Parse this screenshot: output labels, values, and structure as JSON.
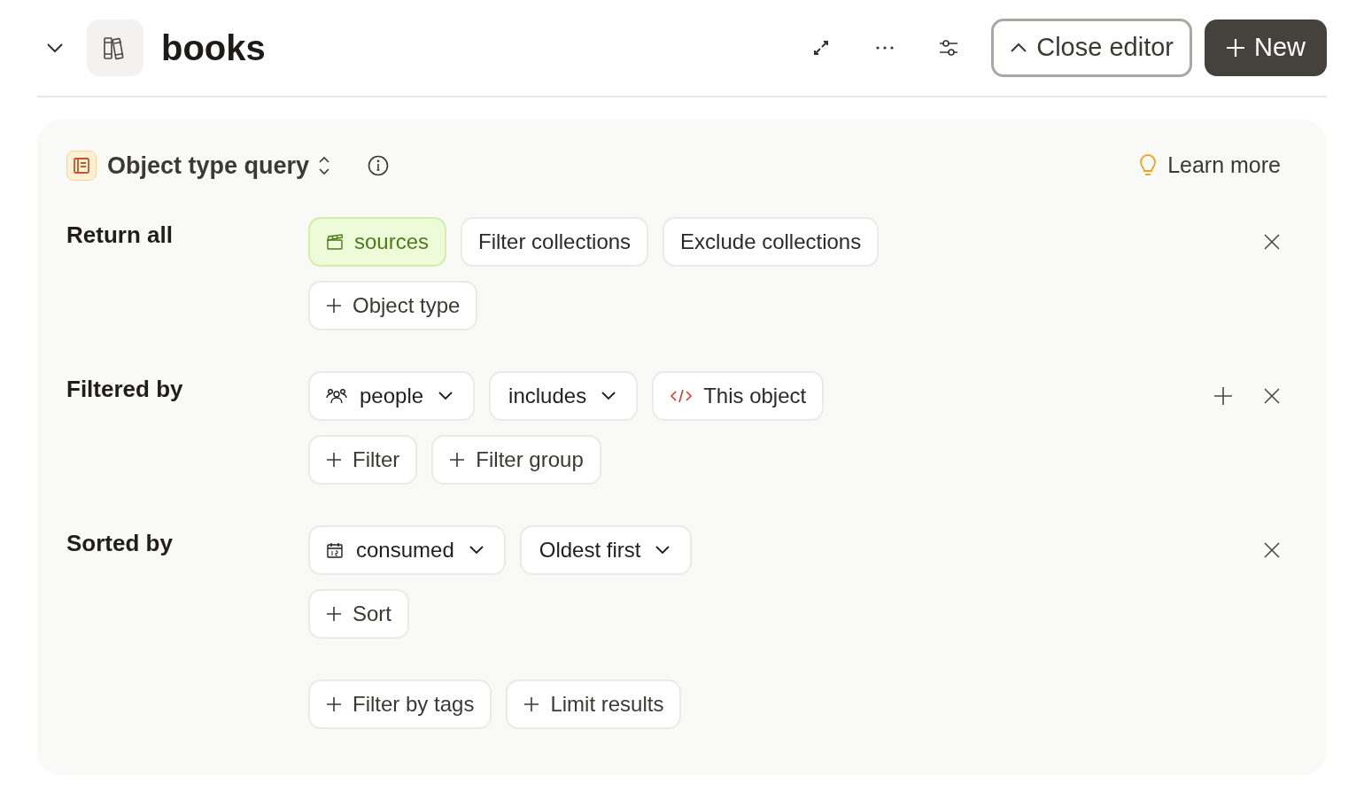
{
  "header": {
    "title": "books",
    "close_editor": "Close editor",
    "new_button": "New"
  },
  "query": {
    "title": "Object type query",
    "learn_more": "Learn more",
    "sections": [
      {
        "label": "Return all",
        "can_add": false,
        "rows": [
          [
            {
              "kind": "object",
              "label": "sources"
            },
            {
              "kind": "plain",
              "label": "Filter collections"
            },
            {
              "kind": "plain",
              "label": "Exclude collections"
            }
          ],
          [
            {
              "kind": "add",
              "label": "Object type"
            }
          ]
        ]
      },
      {
        "label": "Filtered by",
        "can_add": true,
        "rows": [
          [
            {
              "kind": "dropdown",
              "label": "people"
            },
            {
              "kind": "dropdown",
              "label": "includes"
            },
            {
              "kind": "reference",
              "label": "This object"
            }
          ],
          [
            {
              "kind": "add",
              "label": "Filter"
            },
            {
              "kind": "add",
              "label": "Filter group"
            }
          ]
        ]
      },
      {
        "label": "Sorted by",
        "can_add": false,
        "rows": [
          [
            {
              "kind": "dropdown",
              "label": "consumed"
            },
            {
              "kind": "dropdown",
              "label": "Oldest first"
            }
          ],
          [
            {
              "kind": "add",
              "label": "Sort"
            }
          ]
        ]
      }
    ],
    "footer_buttons": [
      "Filter by tags",
      "Limit results"
    ]
  }
}
